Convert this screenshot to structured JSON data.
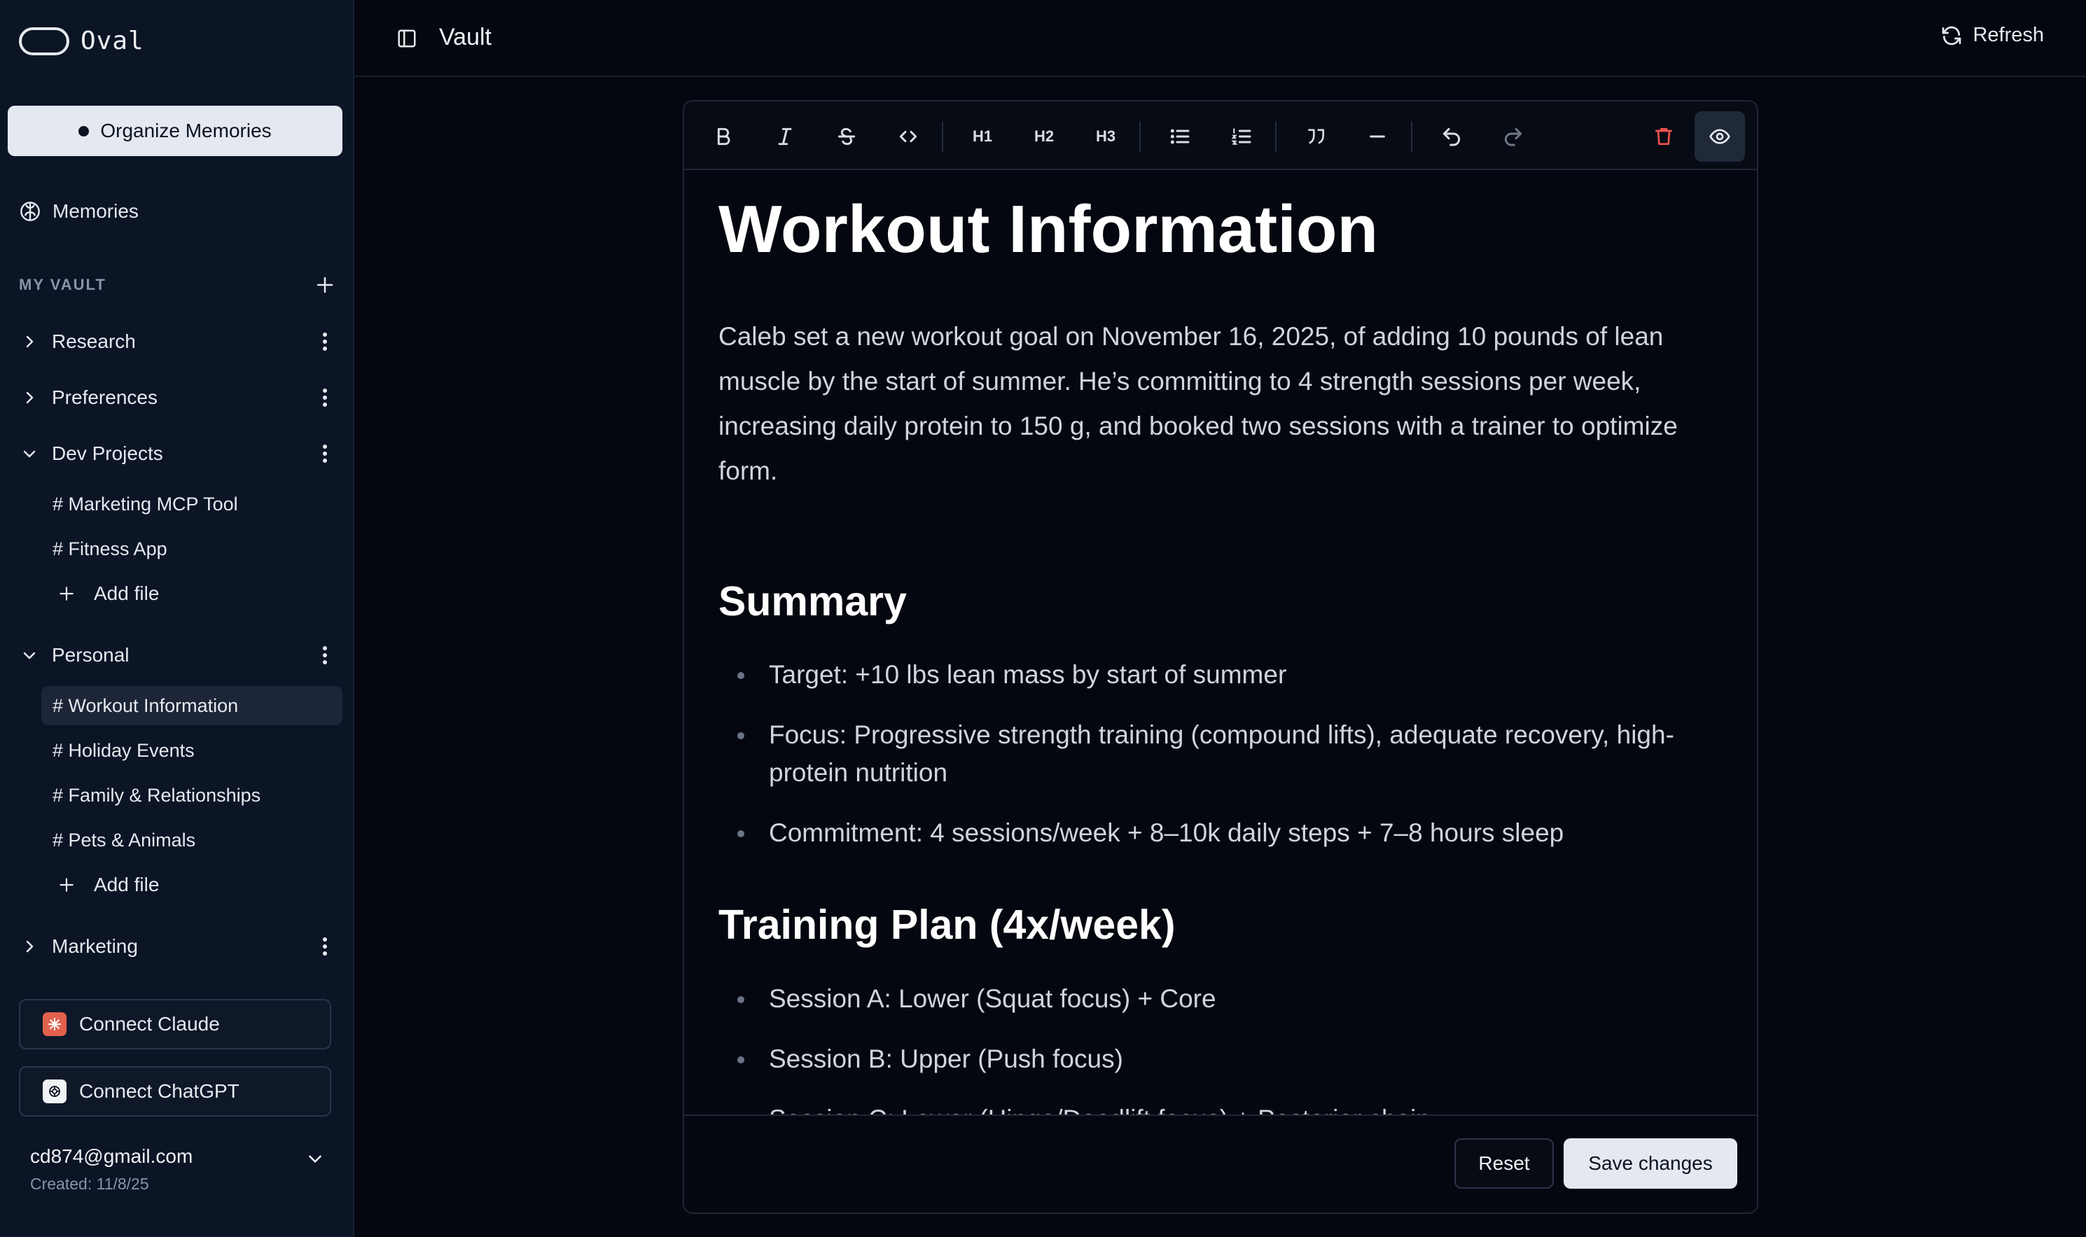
{
  "app": {
    "name": "Oval"
  },
  "sidebar": {
    "organize_label": "Organize Memories",
    "memories_label": "Memories",
    "vault_heading": "MY VAULT",
    "folders": [
      {
        "label": "Research",
        "expanded": false,
        "files": []
      },
      {
        "label": "Preferences",
        "expanded": false,
        "files": []
      },
      {
        "label": "Dev Projects",
        "expanded": true,
        "files": [
          "# Marketing MCP Tool",
          "# Fitness App"
        ],
        "add_label": "Add file"
      },
      {
        "label": "Personal",
        "expanded": true,
        "files": [
          "# Workout Information",
          "# Holiday Events",
          "# Family & Relationships",
          "# Pets & Animals"
        ],
        "add_label": "Add file"
      },
      {
        "label": "Marketing",
        "expanded": false,
        "files": []
      }
    ],
    "active_file": "# Workout Information",
    "connect_claude": "Connect Claude",
    "connect_chatgpt": "Connect ChatGPT",
    "account": {
      "email": "cd874@gmail.com",
      "created": "Created: 11/8/25"
    }
  },
  "topbar": {
    "title": "Vault",
    "refresh_label": "Refresh"
  },
  "toolbar": {
    "h1": "H1",
    "h2": "H2",
    "h3": "H3"
  },
  "document": {
    "title": "Workout Information",
    "lead": "Caleb set a new workout goal on November 16, 2025, of adding 10 pounds of lean muscle by the start of summer. He’s committing to 4 strength sessions per week, increasing daily protein to 150 g, and booked two sessions with a trainer to optimize form.",
    "summary_heading": "Summary",
    "summary": [
      "Target: +10 lbs lean mass by start of summer",
      "Focus: Progressive strength training (compound lifts), adequate recovery, high-protein nutrition",
      "Commitment: 4 sessions/week + 8–10k daily steps + 7–8 hours sleep"
    ],
    "plan_heading": "Training Plan (4x/week)",
    "plan": [
      "Session A: Lower (Squat focus) + Core",
      "Session B: Upper (Push focus)",
      "Session C: Lower (Hinge/Deadlift focus) + Posterior chain"
    ]
  },
  "footer": {
    "reset_label": "Reset",
    "save_label": "Save changes"
  },
  "colors": {
    "background": "#04070f",
    "sidebar": "#0c1526",
    "primary_button": "#e4e8f0",
    "delete_icon": "#ef5350",
    "claude_badge": "#e2614d"
  }
}
